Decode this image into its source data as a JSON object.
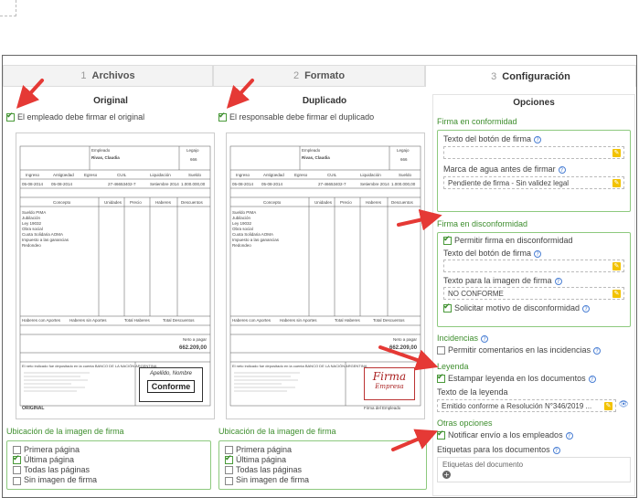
{
  "tabs": [
    {
      "num": "1",
      "label": "Archivos"
    },
    {
      "num": "2",
      "label": "Formato"
    },
    {
      "num": "3",
      "label": "Configuración"
    }
  ],
  "original": {
    "title": "Original",
    "checkbox_label": "El empleado debe firmar el original",
    "location_title": "Ubicación de la imagen de firma",
    "options": [
      "Primera página",
      "Última página",
      "Todas las páginas",
      "Sin imagen de firma"
    ],
    "selected": 1,
    "stamp_top": "Apellido, Nombre",
    "stamp_main": "Conforme",
    "footer_label": "ORIGINAL"
  },
  "duplicate": {
    "title": "Duplicado",
    "checkbox_label": "El responsable debe firmar el duplicado",
    "location_title": "Ubicación de la imagen de firma",
    "options": [
      "Primera página",
      "Última página",
      "Todas las páginas",
      "Sin imagen de firma"
    ],
    "selected": 1,
    "stamp_main": "Firma",
    "stamp_sub": "Empresa",
    "footer_label": "Firma del Empleado"
  },
  "payslip": {
    "employer_label": "Empleado",
    "legajo_label": "Legajo",
    "name": "Rivas, Claudia",
    "legajo": "666",
    "total": "662.209,00",
    "neto_label": "Neto a pagar",
    "headers": [
      "Ingreso",
      "Antigüedad",
      "Egreso",
      "CUIL",
      "Liquidación",
      "Sueldo"
    ],
    "values": [
      "05-08-2014",
      "05-08-2014",
      "",
      "27-46653402-7",
      "Setiembre 2014",
      "1.000.000,00"
    ],
    "concept_headers": [
      "Concepto",
      "Unidades",
      "Precio",
      "Haberes",
      "Descuentos"
    ],
    "concepts": [
      "Sueldo PIMA",
      "Jubilación",
      "Ley 19032",
      "Obra social",
      "Cuota Solidaria AOMA",
      "Impuesto a las ganancias",
      "Redondeo"
    ],
    "bank_text": "El neto indicado fue depositado en la cuenta BANCO DE LA NACIÓN ARGENTINA",
    "bottom_headers": [
      "Haberes con Aportes",
      "Haberes sin Aportes",
      "Total Haberes",
      "Total Descuentos"
    ]
  },
  "options": {
    "title": "Opciones",
    "conformidad": {
      "title": "Firma en conformidad",
      "button_text_label": "Texto del botón de firma",
      "watermark_label": "Marca de agua antes de firmar",
      "watermark_value": "Pendiente de firma - Sin validez legal"
    },
    "disconformidad": {
      "title": "Firma en disconformidad",
      "allow_label": "Permitir firma en disconformidad",
      "button_text_label": "Texto del botón de firma",
      "image_text_label": "Texto para la imagen de firma",
      "image_text_value": "NO CONFORME",
      "reason_label": "Solicitar motivo de disconformidad"
    },
    "incidencias": {
      "title": "Incidencias",
      "allow_label": "Permitir comentarios en las incidencias"
    },
    "leyenda": {
      "title": "Leyenda",
      "stamp_label": "Estampar leyenda en los documentos",
      "text_label": "Texto de la leyenda",
      "text_value": "Emitido conforme a Resolución N°346/2019 ..."
    },
    "otras": {
      "title": "Otras opciones",
      "notify_label": "Notificar envío a los empleados",
      "tags_label": "Etiquetas para los documentos",
      "tags_placeholder": "Etiquetas del documento"
    }
  },
  "colors": {
    "accent": "#3e8e2e",
    "arrow": "#e53935",
    "edit": "#f2c200"
  }
}
